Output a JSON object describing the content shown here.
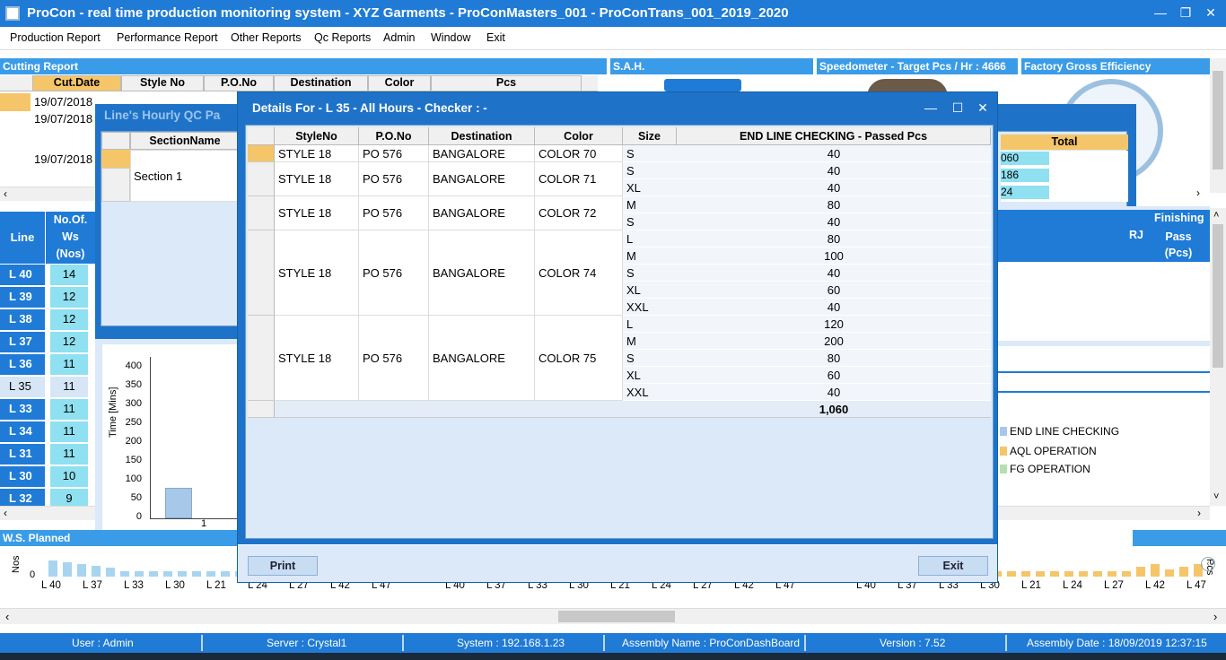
{
  "window": {
    "title": "ProCon - real time production monitoring system - XYZ Garments - ProConMasters_001 - ProConTrans_001_2019_2020"
  },
  "menu": [
    "Production Report",
    "Performance Report",
    "Other Reports",
    "Qc Reports",
    "Admin",
    "Window",
    "Exit"
  ],
  "cutting": {
    "title": "Cutting Report",
    "headers": [
      "Cut.Date",
      "Style No",
      "P.O.No",
      "Destination",
      "Color",
      "Pcs"
    ],
    "dates": [
      "19/07/2018",
      "19/07/2018",
      "19/07/2018"
    ]
  },
  "sah": {
    "title": "S.A.H."
  },
  "speedometer": {
    "title": "Speedometer - Target Pcs / Hr : 4666"
  },
  "efficiency": {
    "title": "Factory Gross Efficiency"
  },
  "qc": {
    "title": "Line's Hourly QC Pa",
    "section_header": "SectionName",
    "section": "Section 1",
    "total_header": "Total",
    "totals": [
      "060",
      "186",
      "24"
    ]
  },
  "lines": {
    "headers": {
      "line": "Line",
      "no_of": "No.Of.",
      "ws": "Ws",
      "nos": "(Nos)"
    },
    "rows": [
      {
        "line": "L 40",
        "ws": "14"
      },
      {
        "line": "L 39",
        "ws": "12"
      },
      {
        "line": "L 38",
        "ws": "12"
      },
      {
        "line": "L 37",
        "ws": "12"
      },
      {
        "line": "L 36",
        "ws": "11"
      },
      {
        "line": "L 35",
        "ws": "11"
      },
      {
        "line": "L 33",
        "ws": "11"
      },
      {
        "line": "L 34",
        "ws": "11"
      },
      {
        "line": "L 31",
        "ws": "11"
      },
      {
        "line": "L 30",
        "ws": "10"
      },
      {
        "line": "L 32",
        "ws": "9"
      }
    ],
    "finishing": {
      "title": "Finishing",
      "pass": "Pass",
      "pcs": "(Pcs)",
      "rj": "RJ"
    }
  },
  "time_chart": {
    "ylabel": "Time [Mins]",
    "yticks": [
      "400",
      "350",
      "300",
      "250",
      "200",
      "150",
      "100",
      "50",
      "0"
    ],
    "xtick": "1"
  },
  "legend": [
    "END LINE CHECKING",
    "AQL OPERATION",
    "FG OPERATION"
  ],
  "ws_planned": {
    "title": "W.S. Planned",
    "ylabel": "Nos",
    "yzero": "0",
    "xticks": [
      "L 40",
      "L 37",
      "L 33",
      "L 30",
      "L 21",
      "L 24",
      "L 27",
      "L 42",
      "L 47"
    ],
    "right_label": "Pcs"
  },
  "modal": {
    "title": "Details For - L 35 - All Hours - Checker :  -",
    "headers": [
      "StyleNo",
      "P.O.No",
      "Destination",
      "Color",
      "Size",
      "END LINE CHECKING - Passed Pcs"
    ],
    "groups": [
      {
        "style": "STYLE 18",
        "po": "PO 576",
        "dest": "BANGALORE",
        "color": "COLOR 70",
        "sizes": [
          {
            "size": "S",
            "pcs": "40"
          }
        ]
      },
      {
        "style": "STYLE 18",
        "po": "PO 576",
        "dest": "BANGALORE",
        "color": "COLOR 71",
        "sizes": [
          {
            "size": "S",
            "pcs": "40"
          },
          {
            "size": "XL",
            "pcs": "40"
          }
        ]
      },
      {
        "style": "STYLE 18",
        "po": "PO 576",
        "dest": "BANGALORE",
        "color": "COLOR 72",
        "sizes": [
          {
            "size": "M",
            "pcs": "80"
          },
          {
            "size": "S",
            "pcs": "40"
          }
        ]
      },
      {
        "style": "STYLE 18",
        "po": "PO 576",
        "dest": "BANGALORE",
        "color": "COLOR 74",
        "sizes": [
          {
            "size": "L",
            "pcs": "80"
          },
          {
            "size": "M",
            "pcs": "100"
          },
          {
            "size": "S",
            "pcs": "40"
          },
          {
            "size": "XL",
            "pcs": "60"
          },
          {
            "size": "XXL",
            "pcs": "40"
          }
        ]
      },
      {
        "style": "STYLE 18",
        "po": "PO 576",
        "dest": "BANGALORE",
        "color": "COLOR 75",
        "sizes": [
          {
            "size": "L",
            "pcs": "120"
          },
          {
            "size": "M",
            "pcs": "200"
          },
          {
            "size": "S",
            "pcs": "80"
          },
          {
            "size": "XL",
            "pcs": "60"
          },
          {
            "size": "XXL",
            "pcs": "40"
          }
        ]
      }
    ],
    "total": "1,060",
    "print_label": "Print",
    "exit_label": "Exit"
  },
  "status": {
    "user": "User : Admin",
    "server": "Server : Crystal1",
    "system": "System : 192.168.1.23",
    "assembly": "Assembly Name : ProConDashBoard",
    "version": "Version : 7.52",
    "date": "Assembly Date : 18/09/2019 12:37:15"
  },
  "colors": {
    "accent": "#1f7bd6",
    "header_blue": "#3a9ce8",
    "ws_cyan": "#8fe0f0",
    "panel_bg": "#dbe9f8"
  }
}
